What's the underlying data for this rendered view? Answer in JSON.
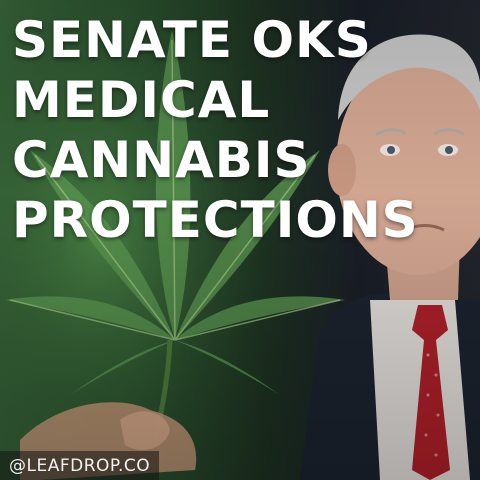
{
  "headline": {
    "line1": "SENATE  OKS",
    "line2": "MEDICAL",
    "line3": "CANNABIS",
    "line4": "PROTECTIONS"
  },
  "handle": "@LEAFDROP.CO",
  "colors": {
    "text": "#ffffff",
    "plant": "#4f8a4a",
    "suit": "#1c2430",
    "tie": "#b3202a"
  },
  "background": {
    "left_subject": "cannabis-leaf",
    "right_subject": "man-in-suit-with-red-tie"
  }
}
